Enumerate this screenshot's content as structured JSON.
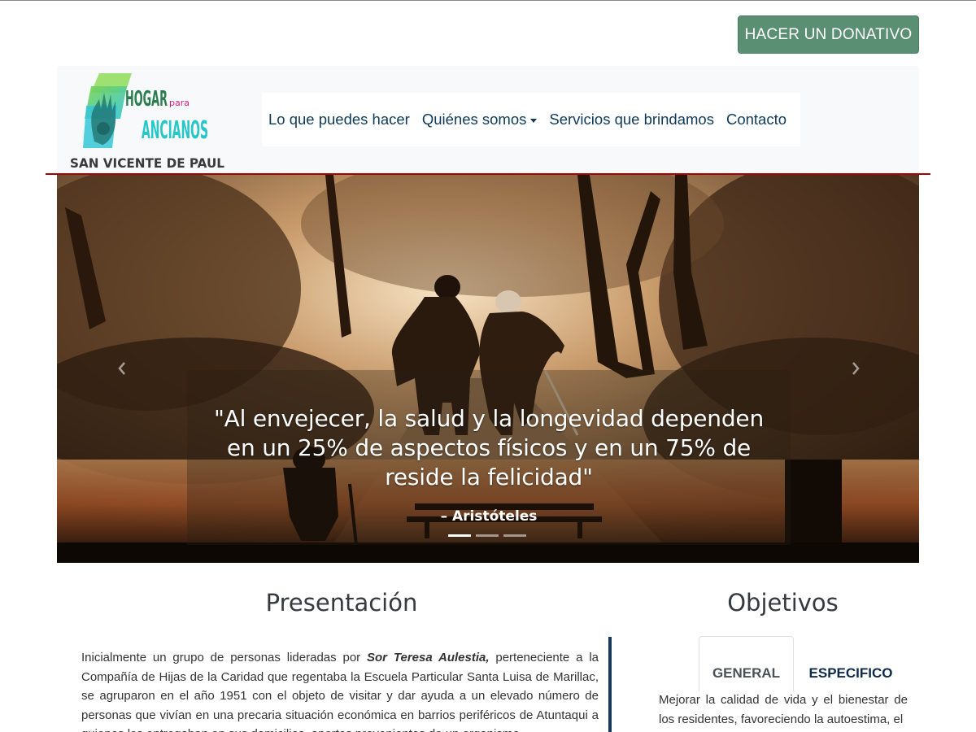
{
  "donate_button": "HACER UN DONATIVO",
  "logo": {
    "line1": "HOGAR",
    "small": "para",
    "line2": "ANCIANOS",
    "line3": "SAN VICENTE DE PAUL"
  },
  "nav": {
    "items": [
      "Lo que puedes hacer",
      "Quiénes somos",
      "Servicios que brindamos",
      "Contacto"
    ]
  },
  "hero": {
    "quote_lines": [
      "\"Al envejecer, la salud y la longevidad dependen",
      "en un 25% de aspectos físicos y en un 75% de",
      "reside la felicidad\""
    ],
    "author": "– Aristóteles",
    "slide_count": 3,
    "active_slide": 0
  },
  "presentacion": {
    "title": "Presentación",
    "text_before": "Inicialmente un grupo de personas lideradas por ",
    "highlight": "Sor Teresa Aulestia,",
    "text_after": " perteneciente a la Compañía de Hijas de la Caridad que regentaba la Escuela Particular Santa Luisa de Marillac, se agruparon en el año 1951 con el objeto de visitar y dar ayuda a un elevado número de personas que vivían en una precaria situación económica en barrios periféricos de Atuntaqui a quienes les entregaban en sus domicilios, aportes provenientes de un organismo"
  },
  "objetivos": {
    "title": "Objetivos",
    "tabs": [
      "GENERAL",
      "ESPECIFICO"
    ],
    "active_tab": "GENERAL",
    "text": "Mejorar la calidad de vida y el bienestar de los residentes, favoreciendo la autoestima, el"
  },
  "colors": {
    "donate": "#5a8f73",
    "nav_text": "#0e3a5a",
    "header_line": "#a40000",
    "divider": "#17395b"
  },
  "icons": [
    "chevron-left-icon",
    "chevron-right-icon",
    "caret-down-icon"
  ]
}
